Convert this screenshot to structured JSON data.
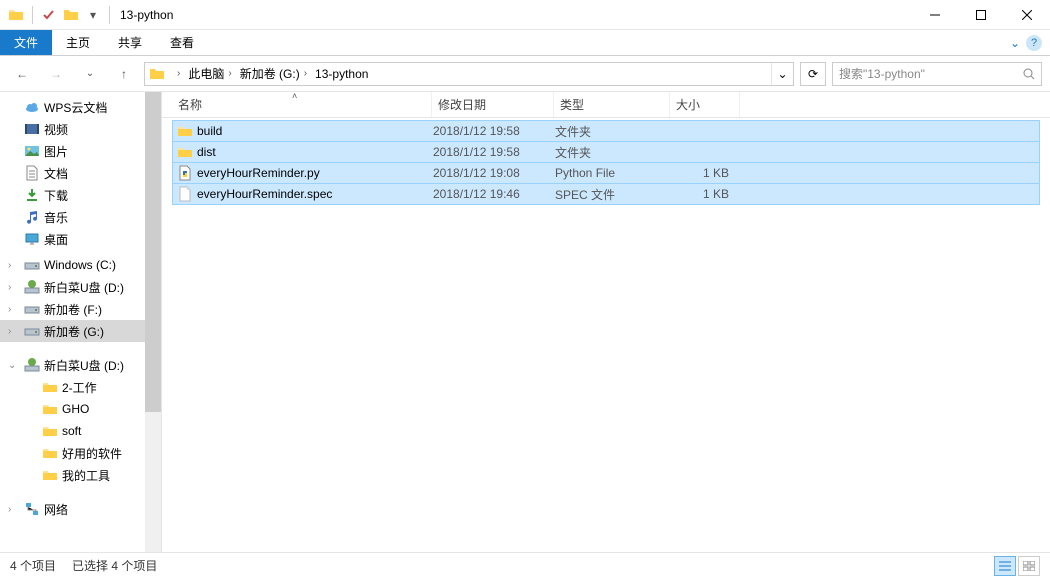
{
  "window": {
    "title": "13-python"
  },
  "ribbon": {
    "file": "文件",
    "home": "主页",
    "share": "共享",
    "view": "查看"
  },
  "breadcrumb": [
    "此电脑",
    "新加卷 (G:)",
    "13-python"
  ],
  "search": {
    "placeholder": "搜索\"13-python\""
  },
  "columns": {
    "name": "名称",
    "date": "修改日期",
    "type": "类型",
    "size": "大小"
  },
  "files": [
    {
      "name": "build",
      "date": "2018/1/12 19:58",
      "type": "文件夹",
      "size": "",
      "icon": "folder"
    },
    {
      "name": "dist",
      "date": "2018/1/12 19:58",
      "type": "文件夹",
      "size": "",
      "icon": "folder"
    },
    {
      "name": "everyHourReminder.py",
      "date": "2018/1/12 19:08",
      "type": "Python File",
      "size": "1 KB",
      "icon": "py"
    },
    {
      "name": "everyHourReminder.spec",
      "date": "2018/1/12 19:46",
      "type": "SPEC 文件",
      "size": "1 KB",
      "icon": "file"
    }
  ],
  "tree": {
    "group1": [
      {
        "label": "WPS云文档",
        "icon": "cloud"
      },
      {
        "label": "视频",
        "icon": "video"
      },
      {
        "label": "图片",
        "icon": "picture"
      },
      {
        "label": "文档",
        "icon": "doc"
      },
      {
        "label": "下载",
        "icon": "download"
      },
      {
        "label": "音乐",
        "icon": "music"
      },
      {
        "label": "桌面",
        "icon": "desktop"
      }
    ],
    "group2": [
      {
        "label": "Windows (C:)",
        "icon": "drive"
      },
      {
        "label": "新白菜U盘 (D:)",
        "icon": "usb"
      },
      {
        "label": "新加卷 (F:)",
        "icon": "drive"
      },
      {
        "label": "新加卷 (G:)",
        "icon": "drive",
        "selected": true
      }
    ],
    "group3": [
      {
        "label": "新白菜U盘 (D:)",
        "icon": "usb",
        "exp": true
      },
      {
        "label": "2-工作",
        "icon": "folder",
        "depth": 1
      },
      {
        "label": "GHO",
        "icon": "folder",
        "depth": 1
      },
      {
        "label": "soft",
        "icon": "folder",
        "depth": 1
      },
      {
        "label": "好用的软件",
        "icon": "folder",
        "depth": 1
      },
      {
        "label": "我的工具",
        "icon": "folder",
        "depth": 1
      }
    ],
    "group4": [
      {
        "label": "网络",
        "icon": "network"
      }
    ]
  },
  "status": {
    "count": "4 个项目",
    "selected": "已选择 4 个项目"
  }
}
